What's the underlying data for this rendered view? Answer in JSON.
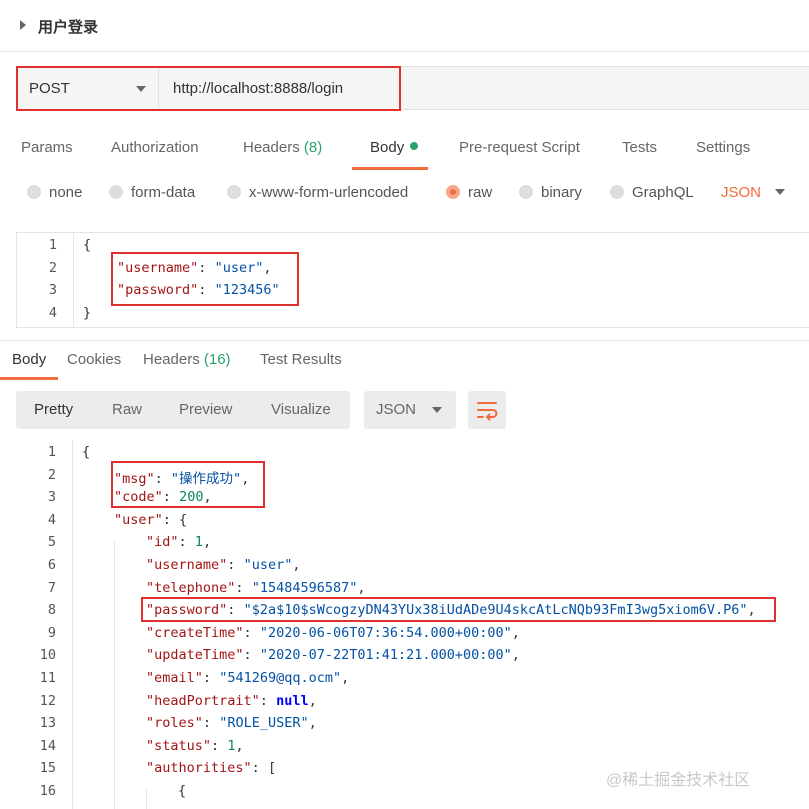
{
  "request": {
    "name": "用户登录",
    "method": "POST",
    "url": "http://localhost:8888/login"
  },
  "request_tabs": [
    {
      "label": "Params",
      "count": ""
    },
    {
      "label": "Authorization",
      "count": ""
    },
    {
      "label": "Headers",
      "count": "(8)"
    },
    {
      "label": "Body",
      "count": ""
    },
    {
      "label": "Pre-request Script",
      "count": ""
    },
    {
      "label": "Tests",
      "count": ""
    },
    {
      "label": "Settings",
      "count": ""
    }
  ],
  "body_options": [
    "none",
    "form-data",
    "x-www-form-urlencoded",
    "raw",
    "binary",
    "GraphQL"
  ],
  "body_format": "JSON",
  "request_body": {
    "line_numbers": [
      "1",
      "2",
      "3",
      "4"
    ],
    "lines": [
      "{",
      "\"username\": \"user\",",
      "\"password\": \"123456\"",
      "}"
    ]
  },
  "response_tabs": [
    {
      "label": "Body",
      "count": ""
    },
    {
      "label": "Cookies",
      "count": ""
    },
    {
      "label": "Headers",
      "count": "(16)"
    },
    {
      "label": "Test Results",
      "count": ""
    }
  ],
  "view_modes": [
    "Pretty",
    "Raw",
    "Preview",
    "Visualize"
  ],
  "response_format": "JSON",
  "response_body": {
    "line_numbers": [
      "1",
      "2",
      "3",
      "4",
      "5",
      "6",
      "7",
      "8",
      "9",
      "10",
      "11",
      "12",
      "13",
      "14",
      "15",
      "16"
    ],
    "lines": [
      "{",
      "\"msg\": \"操作成功\",",
      "\"code\": 200,",
      "\"user\": {",
      "\"id\": 1,",
      "\"username\": \"user\",",
      "\"telephone\": \"15484596587\",",
      "\"password\": \"$2a$10$sWcogzyDN43YUx38iUdADe9U4skcAtLcNQb93FmI3wg5xiom6V.P6\",",
      "\"createTime\": \"2020-06-06T07:36:54.000+00:00\",",
      "\"updateTime\": \"2020-07-22T01:41:21.000+00:00\",",
      "\"email\": \"541269@qq.ocm\",",
      "\"headPortrait\": null,",
      "\"roles\": \"ROLE_USER\",",
      "\"status\": 1,",
      "\"authorities\": [",
      "{"
    ]
  },
  "watermark": "@稀土掘金技术社区",
  "colors": {
    "accent": "#f26b3a",
    "green": "#29a36a",
    "highlight": "#e03131"
  }
}
